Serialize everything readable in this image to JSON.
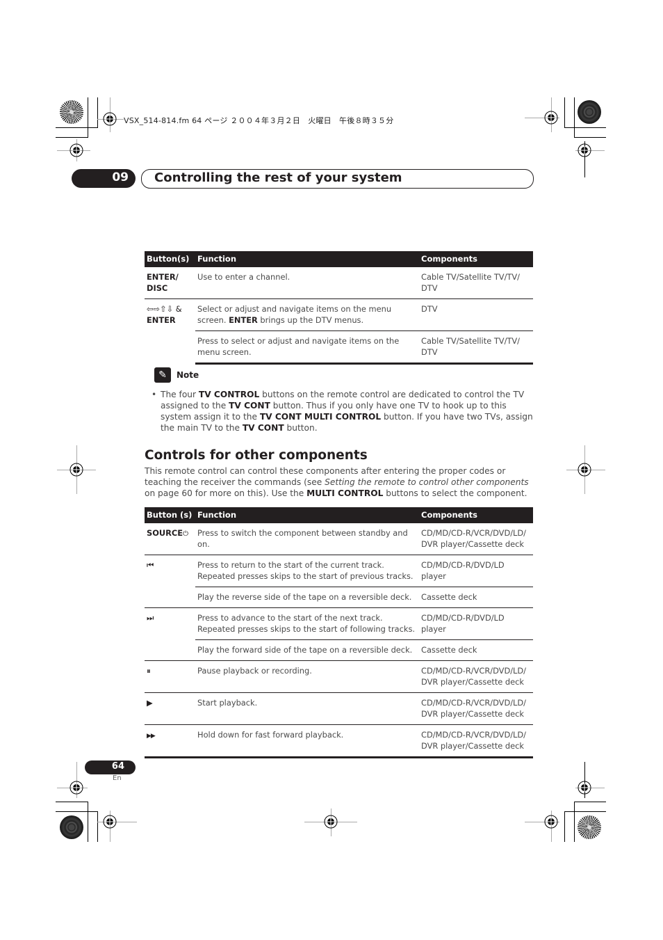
{
  "file_info": "VSX_514-814.fm  64 ページ  ２００４年３月２日　火曜日　午後８時３５分",
  "chapter": {
    "number": "09",
    "title": "Controlling the rest of your system"
  },
  "table1": {
    "headers": [
      "Button(s)",
      "Function",
      "Components"
    ],
    "rows": [
      {
        "button": "ENTER/ DISC",
        "function": "Use to enter a channel.",
        "components": "Cable TV/Satellite TV/TV/ DTV"
      },
      {
        "button_symbols": "⇦⇨⇧⇩ &",
        "button": "ENTER",
        "function_pre_bold": "",
        "function": "Select or adjust and navigate items on the menu screen.",
        "function_bold": "ENTER",
        "function_post": " brings up the DTV menus.",
        "components": "DTV"
      },
      {
        "function": "Press to select or adjust and navigate items on the menu screen.",
        "components": "Cable TV/Satellite TV/TV/ DTV"
      }
    ]
  },
  "note": {
    "icon": "pencil-icon",
    "label": "Note",
    "bullet": "•",
    "parts": [
      {
        "t": "The four ",
        "b": false
      },
      {
        "t": "TV CONTROL",
        "b": true
      },
      {
        "t": " buttons on the remote control are dedicated to control the TV assigned to the ",
        "b": false
      },
      {
        "t": "TV CONT",
        "b": true
      },
      {
        "t": " button. Thus if you only have one TV to hook up to this system assign it to the ",
        "b": false
      },
      {
        "t": "TV CONT MULTI CONTROL",
        "b": true
      },
      {
        "t": " button. If you have two TVs, assign the main TV to the ",
        "b": false
      },
      {
        "t": "TV CONT",
        "b": true
      },
      {
        "t": " button.",
        "b": false
      }
    ]
  },
  "section": {
    "title": "Controls for other components",
    "intro_1": "This remote control can control these components after entering the proper codes or teaching the receiver the commands (see ",
    "intro_italic": "Setting the remote to control other components",
    "intro_2": " on page 60 for more on this). Use the ",
    "intro_bold": "MULTI CONTROL",
    "intro_3": " buttons to select the component."
  },
  "table2": {
    "headers": [
      "Button (s)",
      "Function",
      "Components"
    ],
    "rows": [
      {
        "button": "SOURCE",
        "button_symbol": "⏻",
        "function": "Press to switch the component between standby and on.",
        "components": "CD/MD/CD-R/VCR/DVD/LD/ DVR player/Cassette deck"
      },
      {
        "button_symbol": "⏮",
        "function": "Press to return to the start of the current track. Repeated presses skips to the start of previous tracks.",
        "components": "CD/MD/CD-R/DVD/LD player"
      },
      {
        "function": "Play the reverse side of the tape on a reversible deck.",
        "components": "Cassette deck"
      },
      {
        "button_symbol": "⏭",
        "function": "Press to advance to the start of the next track. Repeated presses skips to the start of following tracks.",
        "components": "CD/MD/CD-R/DVD/LD player"
      },
      {
        "function": "Play the forward side of the tape on a reversible deck.",
        "components": "Cassette deck"
      },
      {
        "button_symbol": "⏸",
        "function": "Pause playback or recording.",
        "components": "CD/MD/CD-R/VCR/DVD/LD/ DVR player/Cassette deck"
      },
      {
        "button_symbol": "▶",
        "function": "Start playback.",
        "components": "CD/MD/CD-R/VCR/DVD/LD/ DVR player/Cassette deck"
      },
      {
        "button_symbol": "▶▶",
        "function": "Hold down for fast forward playback.",
        "components": "CD/MD/CD-R/VCR/DVD/LD/ DVR player/Cassette deck"
      }
    ]
  },
  "footer": {
    "page_number": "64",
    "language": "En"
  }
}
